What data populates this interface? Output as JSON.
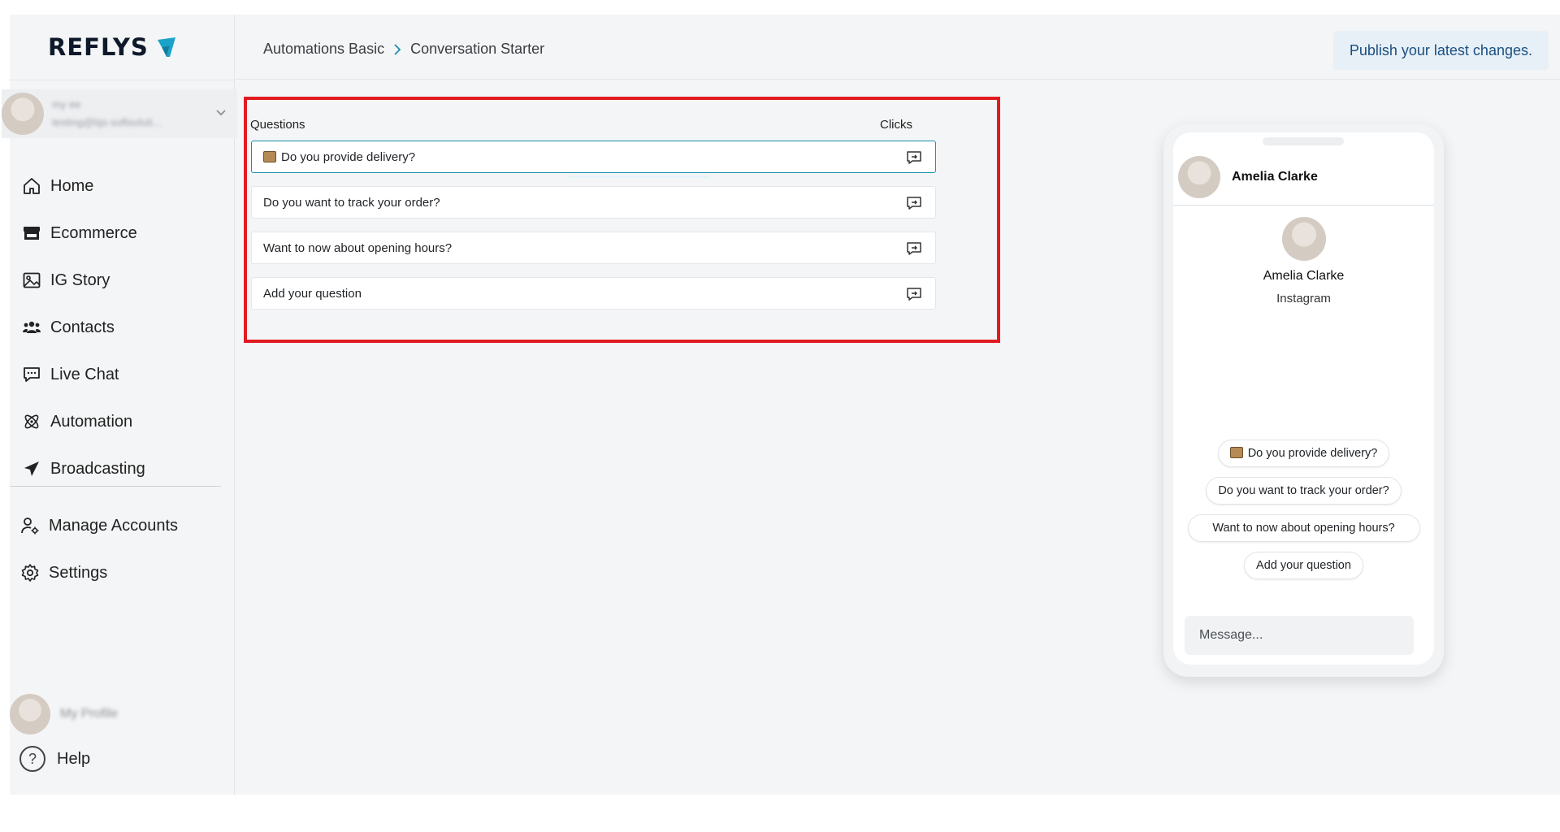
{
  "brand": {
    "name": "REFLYS",
    "accent": "#1aa3c9"
  },
  "account": {
    "name": "my ee",
    "email": "testing@bjs-softsoluti..."
  },
  "sidebar": {
    "items": [
      {
        "label": "Home",
        "icon": "home-icon"
      },
      {
        "label": "Ecommerce",
        "icon": "store-icon"
      },
      {
        "label": "IG Story",
        "icon": "image-icon"
      },
      {
        "label": "Contacts",
        "icon": "users-icon"
      },
      {
        "label": "Live Chat",
        "icon": "chat-icon"
      },
      {
        "label": "Automation",
        "icon": "atom-icon"
      },
      {
        "label": "Broadcasting",
        "icon": "send-icon"
      }
    ],
    "secondary": [
      {
        "label": "Manage Accounts",
        "icon": "user-settings-icon"
      },
      {
        "label": "Settings",
        "icon": "gear-icon"
      }
    ],
    "profile_label": "My Profile",
    "help_label": "Help"
  },
  "header": {
    "breadcrumb": [
      "Automations Basic",
      "Conversation Starter"
    ],
    "publish_label": "Publish your latest changes."
  },
  "questions": {
    "col_questions": "Questions",
    "col_clicks": "Clicks",
    "rows": [
      {
        "text": "Do you provide delivery?",
        "emoji": "package"
      },
      {
        "text": "Do you want to track your order?"
      },
      {
        "text": "Want to now about opening hours?"
      },
      {
        "text": "Add your question"
      }
    ]
  },
  "preview": {
    "header_name": "Amelia Clarke",
    "profile_name": "Amelia Clarke",
    "platform": "Instagram",
    "chips": [
      "Do you provide delivery?",
      "Do you want to track your order?",
      "Want to now about opening hours?",
      "Add your question"
    ],
    "message_placeholder": "Message..."
  }
}
